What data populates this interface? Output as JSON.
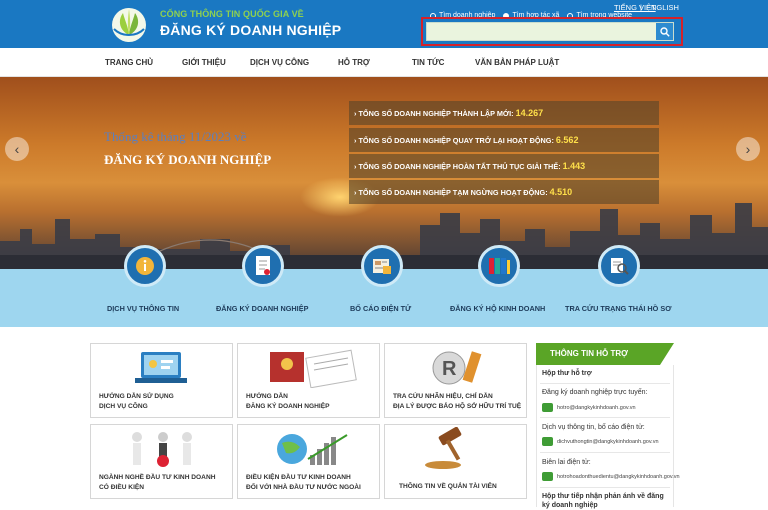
{
  "header": {
    "portal_top": "CỔNG THÔNG TIN QUỐC GIA VỀ",
    "portal_main": "ĐĂNG KÝ DOANH NGHIỆP",
    "lang_vi": "TIẾNG VIỆT",
    "lang_en": "ENGLISH",
    "search_options": [
      "Tìm doanh nghiệp",
      "Tìm hợp tác xã",
      "Tìm trong website"
    ],
    "search_selected": "Tìm hợp tác xã",
    "search_value": "",
    "search_icon": "search-icon",
    "color": "#1a78c2",
    "highlight_color": "#d4222a"
  },
  "nav": [
    "TRANG CHỦ",
    "GIỚI THIỆU",
    "DỊCH VỤ CÔNG",
    "HỖ TRỢ",
    "TIN TỨC",
    "VĂN BẢN PHÁP LUẬT"
  ],
  "hero": {
    "subtitle": "Thống kê tháng 11/2023 về",
    "title": "ĐĂNG KÝ DOANH NGHIỆP",
    "stats": [
      {
        "label": "TỔNG SỐ DOANH NGHIỆP THÀNH LẬP MỚI:",
        "value": "14.267"
      },
      {
        "label": "TỔNG SỐ DOANH NGHIỆP QUAY TRỞ LẠI HOẠT ĐỘNG:",
        "value": "6.562"
      },
      {
        "label": "TỔNG SỐ DOANH NGHIỆP HOÀN TẤT THỦ TỤC GIẢI THỂ:",
        "value": "1.443"
      },
      {
        "label": "TỔNG SỐ DOANH NGHIỆP TẠM NGỪNG HOẠT ĐỘNG:",
        "value": "4.510"
      }
    ],
    "prev_icon": "chevron-left-icon",
    "next_icon": "chevron-right-icon"
  },
  "services": [
    {
      "label": "DỊCH VỤ THÔNG TIN",
      "icon": "info-icon"
    },
    {
      "label": "ĐĂNG KÝ DOANH NGHIỆP",
      "icon": "document-icon"
    },
    {
      "label": "BỐ CÁO ĐIỆN TỬ",
      "icon": "newspaper-icon"
    },
    {
      "label": "ĐĂNG KÝ HỘ KINH DOANH",
      "icon": "binders-icon"
    },
    {
      "label": "TRA CỨU TRẠNG THÁI HỒ SƠ",
      "icon": "search-file-icon"
    }
  ],
  "cards": [
    {
      "line1": "HƯỚNG DẪN SỬ DỤNG",
      "line2": "DỊCH VỤ CÔNG"
    },
    {
      "line1": "HƯỚNG DẪN",
      "line2": "ĐĂNG KÝ DOANH NGHIỆP"
    },
    {
      "line1": "TRA CỨU NHÃN HIỆU, CHỈ DẪN",
      "line2": "ĐỊA LÝ ĐƯỢC BẢO HỘ SỞ HỮU TRÍ TUỆ"
    },
    {
      "line1": "NGÀNH NGHỀ ĐẦU TƯ KINH DOANH",
      "line2": "CÓ ĐIỀU KIỆN"
    },
    {
      "line1": "ĐIỀU KIỆN ĐẦU TƯ KINH DOANH",
      "line2": "ĐỐI VỚI NHÀ ĐẦU TƯ NƯỚC NGOÀI"
    },
    {
      "line1": "THÔNG TIN VỀ QUẢN TÀI VIÊN",
      "line2": ""
    }
  ],
  "support": {
    "title": "THÔNG TIN HỖ TRỢ",
    "mailbox": "Hộp thư hỗ trợ",
    "items": [
      {
        "label": "Đăng ký doanh nghiệp trực tuyến:",
        "email": "hotro@dangkykinhdoanh.gov.vn"
      },
      {
        "label": "Dịch vụ thông tin, bố cáo điện tử:",
        "email": "dichvuthongtin@dangkykinhdoanh.gov.vn"
      },
      {
        "label": "Biên lai điện tử:",
        "email": "hotrohoadonthuedientu@dangkykinhdoanh.gov.vn"
      }
    ],
    "footer": "Hộp thư tiếp nhận phản ánh về đăng ký doanh nghiệp"
  }
}
